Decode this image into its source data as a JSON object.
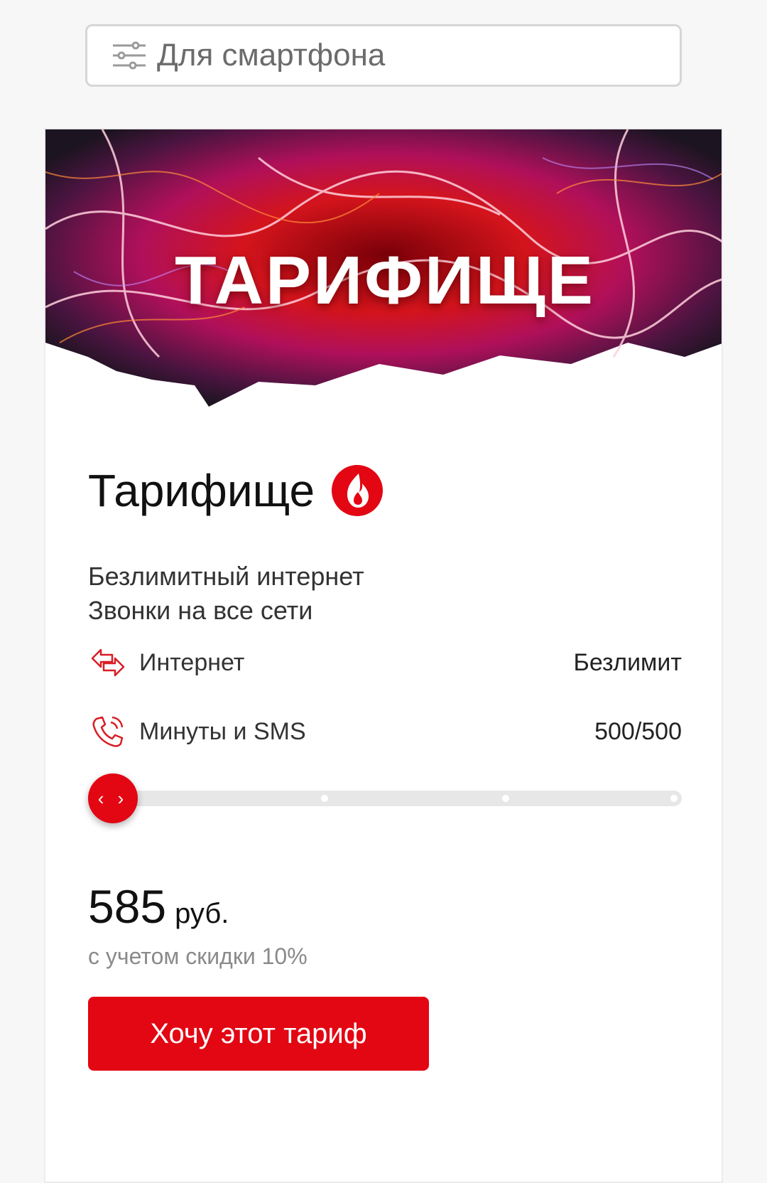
{
  "filter": {
    "label": "Для смартфона",
    "icon": "sliders-icon"
  },
  "banner": {
    "title": "ТАРИФИЩЕ"
  },
  "plan": {
    "name": "Тарифище",
    "badge_icon": "flame-icon",
    "description": [
      "Безлимитный интернет",
      "Звонки на все сети"
    ],
    "features": [
      {
        "label": "Интернет",
        "value": "Безлимит",
        "icon": "data-transfer-icon"
      },
      {
        "label": "Минуты и SMS",
        "value": "500/500",
        "icon": "phone-call-icon"
      }
    ],
    "slider": {
      "knob_glyph": "‹ ›",
      "selected_index": 0,
      "steps": 4
    },
    "price": {
      "amount": "585",
      "currency": "руб.",
      "note": "с учетом скидки 10%"
    },
    "cta_label": "Хочу этот тариф"
  },
  "colors": {
    "accent": "#e30613",
    "text": "#111111",
    "muted": "#8a8a8a"
  }
}
